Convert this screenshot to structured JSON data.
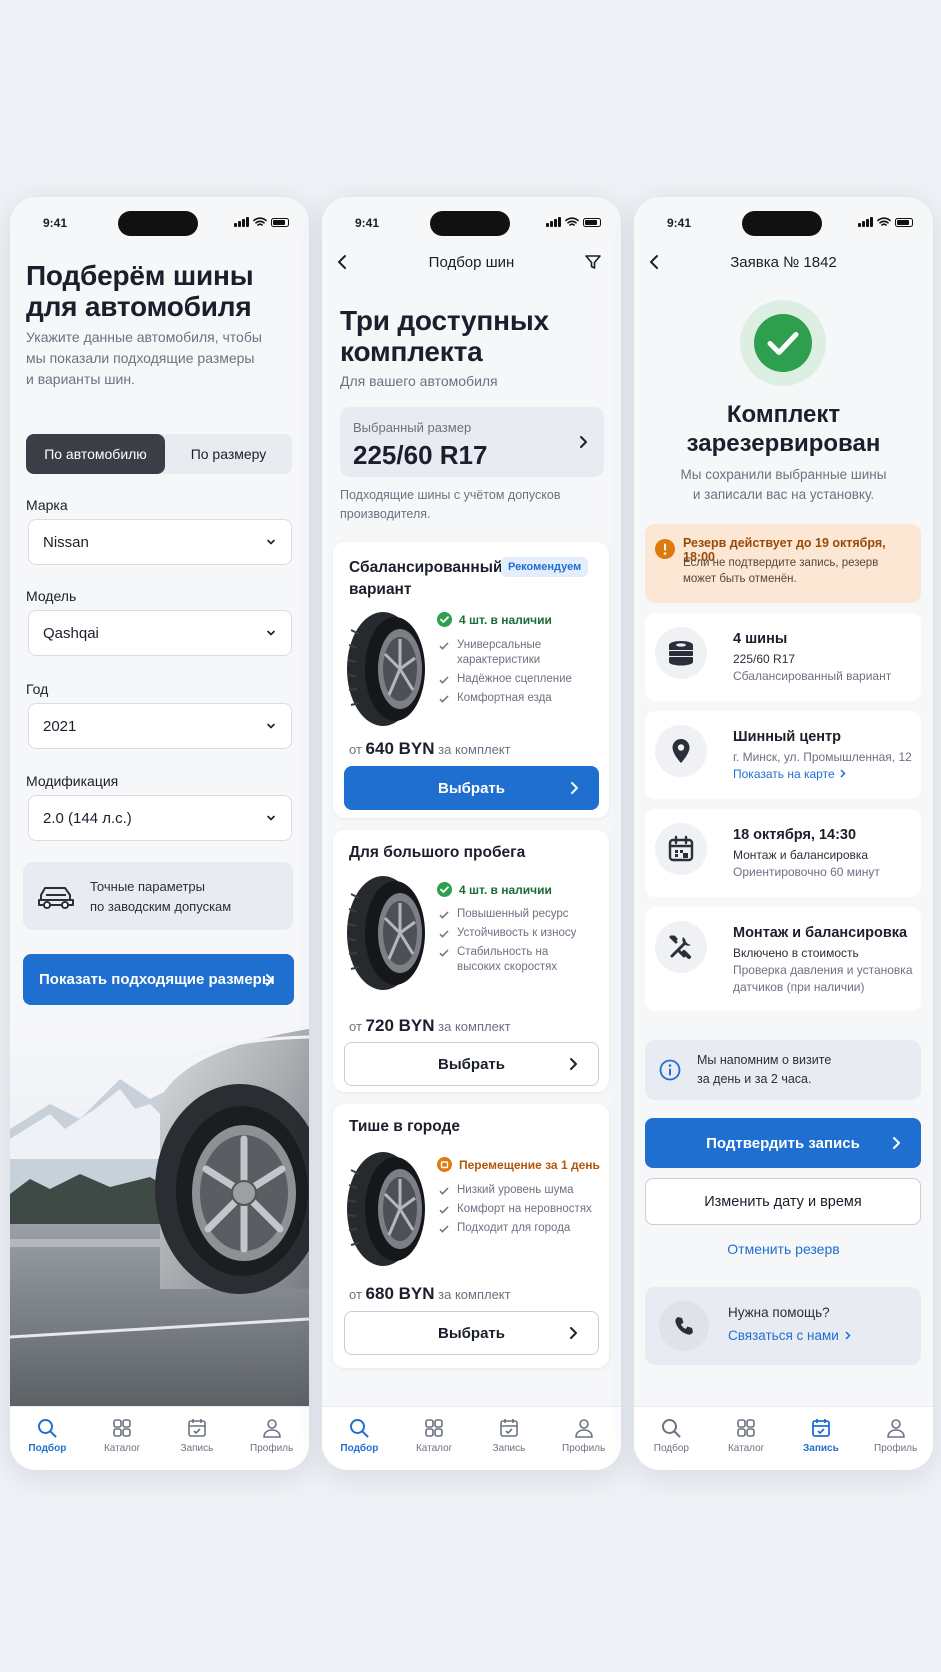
{
  "status_time": "9:41",
  "tabs": [
    "Подбор",
    "Каталог",
    "Запись",
    "Профиль"
  ],
  "screen1": {
    "title_line1": "Подберём шины",
    "title_line2": "для автомобиля",
    "subtitle_line1": "Укажите данные автомобиля, чтобы",
    "subtitle_line2": "мы показали подходящие размеры",
    "subtitle_line3": "и варианты шин.",
    "segment_active": "По автомобилю",
    "segment_other": "По размеру",
    "fields": [
      {
        "label": "Марка",
        "value": "Nissan"
      },
      {
        "label": "Модель",
        "value": "Qashqai"
      },
      {
        "label": "Год",
        "value": "2021"
      },
      {
        "label": "Модификация",
        "value": "2.0 (144 л.с.)"
      }
    ],
    "hint_line1": "Точные параметры",
    "hint_line2": "по заводским допускам",
    "cta": "Показать подходящие размеры"
  },
  "screen2": {
    "nav_title": "Подбор шин",
    "title_line1": "Три доступных",
    "title_line2": "комплекта",
    "subtitle": "Для вашего автомобиля",
    "size_label": "Выбранный размер",
    "size_value": "225/60 R17",
    "note_line1": "Подходящие шины с учётом допусков",
    "note_line2": "производителя.",
    "price_prefix": "от",
    "price_suffix": "за комплект",
    "select_label": "Выбрать",
    "offers": [
      {
        "title_line1": "Сбалансированный",
        "title_line2": "вариант",
        "badge": "Рекомендуем",
        "availability": "4 шт. в наличии",
        "features": [
          "Универсальные характеристики",
          "Надёжное сцепление",
          "Комфортная езда"
        ],
        "price": "640 BYN"
      },
      {
        "title_line1": "Для большого пробега",
        "availability": "4 шт. в наличии",
        "features": [
          "Повышенный ресурс",
          "Устойчивость к износу",
          "Стабильность на высоких скоростях"
        ],
        "price": "720 BYN"
      },
      {
        "title_line1": "Тише в городе",
        "availability": "Перемещение за 1 день",
        "features": [
          "Низкий уровень шума",
          "Комфорт на неровностях",
          "Подходит для города"
        ],
        "price": "680 BYN"
      }
    ]
  },
  "screen3": {
    "nav_title": "Заявка № 1842",
    "title_line1": "Комплект",
    "title_line2": "зарезервирован",
    "subtitle_line1": "Мы сохранили выбранные шины",
    "subtitle_line2": "и записали вас на установку.",
    "warning_title": "Резерв действует до 19 октября, 18:00",
    "warning_line1": "Если не подтвердите запись, резерв",
    "warning_line2": "может быть отменён.",
    "tires_title": "4 шины",
    "tires_size": "225/60 R17",
    "tires_variant": "Сбалансированный вариант",
    "center_title": "Шинный центр",
    "center_address": "г. Минск, ул. Промышленная, 12",
    "center_link": "Показать на карте",
    "date_title": "18 октября, 14:30",
    "date_service": "Монтаж и балансировка",
    "date_duration": "Ориентировочно 60 минут",
    "mount_title": "Монтаж и балансировка",
    "mount_line1": "Включено в стоимость",
    "mount_line2": "Проверка давления и установка",
    "mount_line3": "датчиков (при наличии)",
    "reminder_line1": "Мы напомним о визите",
    "reminder_line2": "за день и за 2 часа.",
    "confirm": "Подтвердить запись",
    "change": "Изменить дату и время",
    "cancel": "Отменить резерв",
    "help_title": "Нужна помощь?",
    "help_link": "Связаться с нами"
  },
  "colors": {
    "accent": "#1f6fd1",
    "success": "#2e9e4f",
    "warning": "#e07a10",
    "dark_segment": "#3a3f47"
  }
}
